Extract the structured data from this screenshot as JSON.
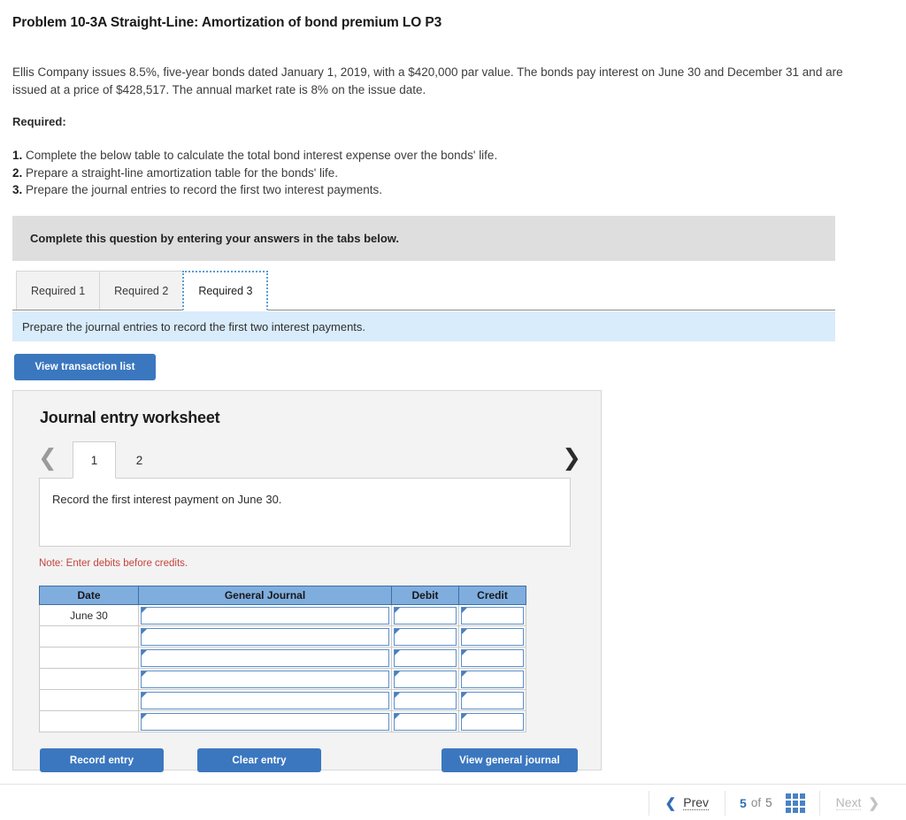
{
  "problem": {
    "title": "Problem 10-3A Straight-Line: Amortization of bond premium LO P3",
    "body": "Ellis Company issues 8.5%, five-year bonds dated January 1, 2019, with a $420,000 par value. The bonds pay interest on June 30 and December 31 and are issued at a price of $428,517. The annual market rate is 8% on the issue date.",
    "required_label": "Required:",
    "requirements": [
      {
        "num": "1.",
        "text": "Complete the below table to calculate the total bond interest expense over the bonds' life."
      },
      {
        "num": "2.",
        "text": "Prepare a straight-line amortization table for the bonds' life."
      },
      {
        "num": "3.",
        "text": "Prepare the journal entries to record the first two interest payments."
      }
    ]
  },
  "instruction_banner": "Complete this question by entering your answers in the tabs below.",
  "tabs": [
    {
      "label": "Required 1",
      "active": false
    },
    {
      "label": "Required 2",
      "active": false
    },
    {
      "label": "Required 3",
      "active": true
    }
  ],
  "sub_instruction": "Prepare the journal entries to record the first two interest payments.",
  "view_transaction_button": "View transaction list",
  "worksheet": {
    "title": "Journal entry worksheet",
    "prev_icon": "chevron-left-icon",
    "next_icon": "chevron-right-icon",
    "entry_tabs": [
      {
        "label": "1",
        "active": true
      },
      {
        "label": "2",
        "active": false
      }
    ],
    "description": "Record the first interest payment on June 30.",
    "note": "Note: Enter debits before credits.",
    "table": {
      "headers": [
        "Date",
        "General Journal",
        "Debit",
        "Credit"
      ],
      "rows": [
        {
          "date": "June 30",
          "general_journal": "",
          "debit": "",
          "credit": ""
        },
        {
          "date": "",
          "general_journal": "",
          "debit": "",
          "credit": ""
        },
        {
          "date": "",
          "general_journal": "",
          "debit": "",
          "credit": ""
        },
        {
          "date": "",
          "general_journal": "",
          "debit": "",
          "credit": ""
        },
        {
          "date": "",
          "general_journal": "",
          "debit": "",
          "credit": ""
        },
        {
          "date": "",
          "general_journal": "",
          "debit": "",
          "credit": ""
        }
      ]
    },
    "buttons": {
      "record": "Record entry",
      "clear": "Clear entry",
      "view_journal": "View general journal"
    }
  },
  "pager": {
    "prev_label": "Prev",
    "next_label": "Next",
    "current": "5",
    "of_label": "of",
    "total": "5",
    "grid_icon": "grid-menu-icon"
  },
  "colors": {
    "accent_blue": "#3b77bf",
    "table_header_blue": "#7fadde",
    "sub_instruction_blue": "#d9ecfb",
    "banner_grey": "#dedede",
    "note_red": "#c4453c"
  }
}
